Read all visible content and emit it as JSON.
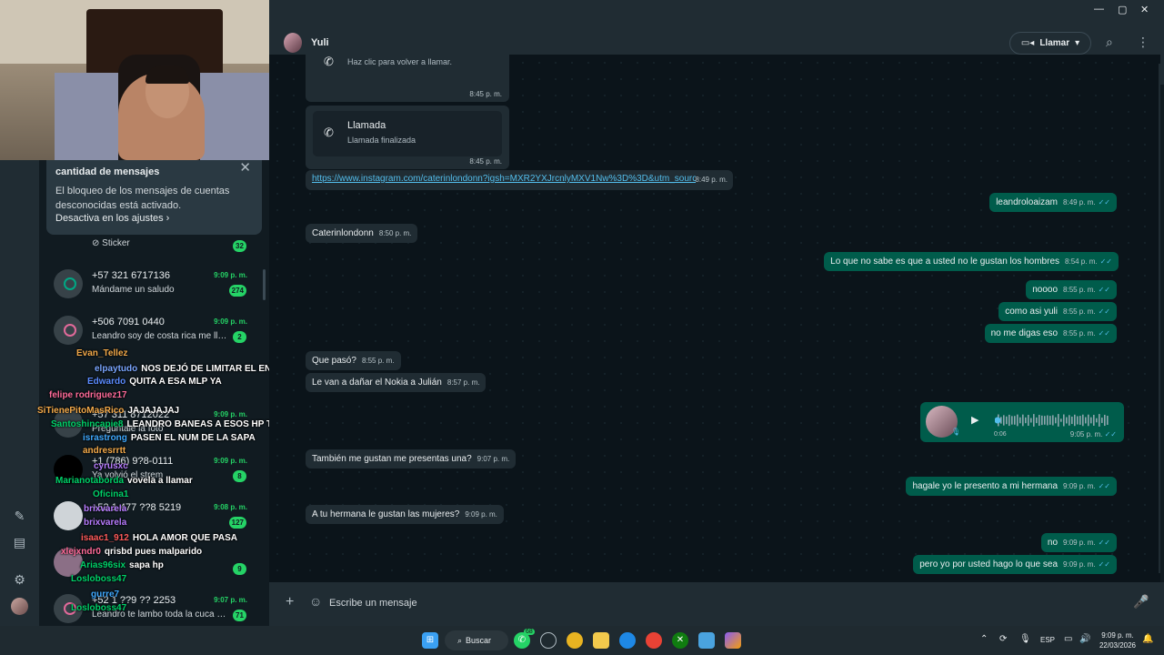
{
  "window": {
    "minimize": "—",
    "maximize": "▢",
    "close": "✕"
  },
  "notice": {
    "title": "cantidad de mensajes",
    "body": "El bloqueo de los mensajes de cuentas desconocidas está activado.",
    "link": "Desactiva en los ajustes ›"
  },
  "chats": [
    {
      "name": "",
      "preview": "Sticker",
      "time": "",
      "badge": "32"
    },
    {
      "name": "+57 321 6717136",
      "preview": "Mándame un saludo",
      "time": "9:09 p. m.",
      "badge": "274"
    },
    {
      "name": "+506 7091 0440",
      "preview": "Leandro soy de costa rica me llam...",
      "time": "9:09 p. m.",
      "badge": "2"
    },
    {
      "name": "+57 311 8712022",
      "preview": "Pregúntale la foto",
      "time": "9:09 p. m.",
      "badge": ""
    },
    {
      "name": "+1 (786) 9?8-0111",
      "preview": "Ya volvió el strem",
      "time": "9:09 p. m.",
      "badge": "8"
    },
    {
      "name": "+52 1 477 ??8 5219",
      "preview": "",
      "time": "9:08 p. m.",
      "badge": "127"
    },
    {
      "name": "",
      "preview": "",
      "time": "",
      "badge": "9"
    },
    {
      "name": "+52 1 ??9 ?? 2253",
      "preview": "Leandro te lambo toda la cuca sal...",
      "time": "9:07 p. m.",
      "badge": "71"
    }
  ],
  "stream_chat": [
    {
      "user": "Evan_Tellez",
      "msg": "",
      "color": "#f2a94a"
    },
    {
      "user": "elpaytudo",
      "msg": "NOS DEJÓ DE LIMITAR EL ENANO? ❌",
      "color": "#7aa6ff"
    },
    {
      "user": "Edwardo",
      "msg": "QUITA A ESA MLP YA",
      "color": "#5b8cff"
    },
    {
      "user": "felipe rodriguez17",
      "msg": "",
      "color": "#ff6b9a"
    },
    {
      "user": "SiTienePitoMasRico",
      "msg": "JAJAJAJAJ",
      "color": "#f2a94a"
    },
    {
      "user": "Santoshincapie8",
      "msg": "LEANDRO BANEAS A ESOS HP T C",
      "color": "#00d26a"
    },
    {
      "user": "israstrong",
      "msg": "PASEN EL NUM DE LA SAPA",
      "color": "#3fa9ff"
    },
    {
      "user": "andresrrtt",
      "msg": "",
      "color": "#f2a94a"
    },
    {
      "user": "cyrusxc",
      "msg": "",
      "color": "#b77cff"
    },
    {
      "user": "Marianotaborda",
      "msg": "vovela a llamar",
      "color": "#00d26a"
    },
    {
      "user": "Oficina1",
      "msg": "",
      "color": "#00d26a"
    },
    {
      "user": "brixvarela",
      "msg": "",
      "color": "#b77cff"
    },
    {
      "user": "brixvarela",
      "msg": "",
      "color": "#b77cff"
    },
    {
      "user": "isaac1_912",
      "msg": "HOLA AMOR QUE PASA",
      "color": "#ff5b5b"
    },
    {
      "user": "xlejxndr0",
      "msg": "qrisbd pues malparido",
      "color": "#ff6b9a"
    },
    {
      "user": "Arias96six",
      "msg": "sapa hp",
      "color": "#00d26a"
    },
    {
      "user": "Losloboss47",
      "msg": "",
      "color": "#00d26a"
    },
    {
      "user": "gurre7",
      "msg": "",
      "color": "#3fa9ff"
    },
    {
      "user": "Losloboss47",
      "msg": "",
      "color": "#00d26a"
    }
  ],
  "header": {
    "contact": "Yuli",
    "call_label": "Llamar"
  },
  "messages": {
    "call1_sub": "Haz clic para volver a llamar.",
    "call1_time": "8:45 p. m.",
    "call2_title": "Llamada",
    "call2_sub": "Llamada finalizada",
    "call2_time": "8:45 p. m.",
    "link": "https://www.instagram.com/caterinlondonn?igsh=MXR2YXJrcnlyMXV1Nw%3D%3D&utm_source=qr",
    "link_time": "8:49 p. m.",
    "list": [
      {
        "dir": "out",
        "text": "leandroloaizam",
        "time": "8:49 p. m."
      },
      {
        "dir": "in",
        "text": "Caterinlondonn",
        "time": "8:50 p. m."
      },
      {
        "dir": "out",
        "text": "Lo que no sabe es que a usted no le gustan los hombres",
        "time": "8:54 p. m."
      },
      {
        "dir": "out",
        "text": "noooo",
        "time": "8:55 p. m."
      },
      {
        "dir": "out",
        "text": "como asi yuli",
        "time": "8:55 p. m."
      },
      {
        "dir": "out",
        "text": "no me digas eso",
        "time": "8:55 p. m."
      },
      {
        "dir": "in",
        "text": "Que pasó?",
        "time": "8:55 p. m."
      },
      {
        "dir": "in",
        "text": "Le van a dañar el Nokia a Julián",
        "time": "8:57 p. m."
      },
      {
        "dir": "in",
        "text": "También me gustan me presentas una?",
        "time": "9:07 p. m."
      },
      {
        "dir": "out",
        "text": "hagale yo le presento a mi hermana",
        "time": "9:09 p. m."
      },
      {
        "dir": "in",
        "text": "A tu hermana le gustan las mujeres?",
        "time": "9:09 p. m."
      },
      {
        "dir": "out",
        "text": "no",
        "time": "9:09 p. m."
      },
      {
        "dir": "out",
        "text": "pero yo por usted hago lo que sea",
        "time": "9:09 p. m."
      }
    ],
    "voice": {
      "duration": "0:06",
      "time": "9:05 p. m.",
      "progress": 0.02
    }
  },
  "composer": {
    "placeholder": "Escribe un mensaje"
  },
  "taskbar": {
    "search": "Buscar",
    "whatsapp_badge": "68",
    "lang": "ESP",
    "time": "9:09 p. m.",
    "date": "22/03/2026"
  },
  "colors": {
    "accent": "#25d366",
    "outgoing": "#005c4b",
    "incoming": "#202c33",
    "background": "#0b141a",
    "link": "#53bdeb"
  }
}
